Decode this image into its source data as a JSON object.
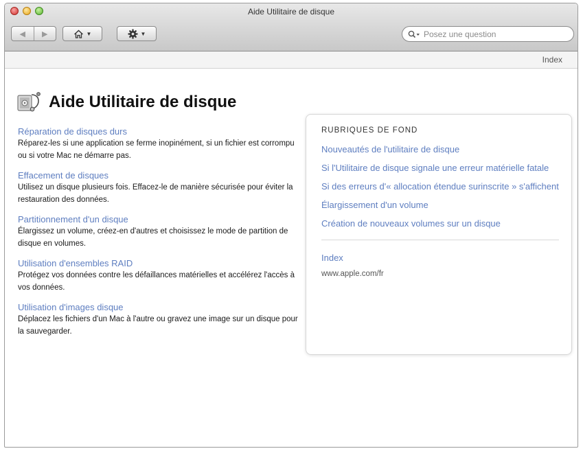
{
  "window": {
    "title": "Aide Utilitaire de disque"
  },
  "toolbar": {
    "back_label": "◀",
    "forward_label": "▶",
    "search_placeholder": "Posez une question"
  },
  "index_bar": {
    "index_label": "Index"
  },
  "page": {
    "title": "Aide Utilitaire de disque",
    "topics": [
      {
        "title": "Réparation de disques durs",
        "description": "Réparez-les si une application se ferme inopinément, si un fichier est corrompu ou si votre Mac ne démarre pas."
      },
      {
        "title": "Effacement de disques",
        "description": "Utilisez un disque plusieurs fois. Effacez-le de manière sécurisée pour éviter la restauration des données."
      },
      {
        "title": "Partitionnement d'un disque",
        "description": "Élargissez un volume, créez-en d'autres et choisissez le mode de partition de disque en volumes."
      },
      {
        "title": "Utilisation d'ensembles RAID",
        "description": "Protégez vos données contre les défaillances matérielles et accélérez l'accès à vos données."
      },
      {
        "title": "Utilisation d'images disque",
        "description": "Déplacez les fichiers d'un Mac à l'autre ou gravez une image sur un disque pour la sauvegarder."
      }
    ]
  },
  "sidebar": {
    "heading": "RUBRIQUES DE FOND",
    "links": [
      "Nouveautés de l'utilitaire de disque",
      "Si l'Utilitaire de disque signale une erreur matérielle fatale",
      "Si des erreurs d'« allocation étendue surinscrite » s'affichent",
      "Élargissement d'un volume",
      "Création de nouveaux volumes sur un disque"
    ],
    "index_label": "Index",
    "website": "www.apple.com/fr"
  },
  "colors": {
    "link": "#5e7ec0",
    "titlebar_top": "#e8e8e8",
    "titlebar_bottom": "#c8c8c8"
  },
  "icons": {
    "app_icon": "disk-utility-stethoscope-icon",
    "home": "home-icon",
    "action": "gear-icon",
    "search": "magnifier-icon"
  }
}
